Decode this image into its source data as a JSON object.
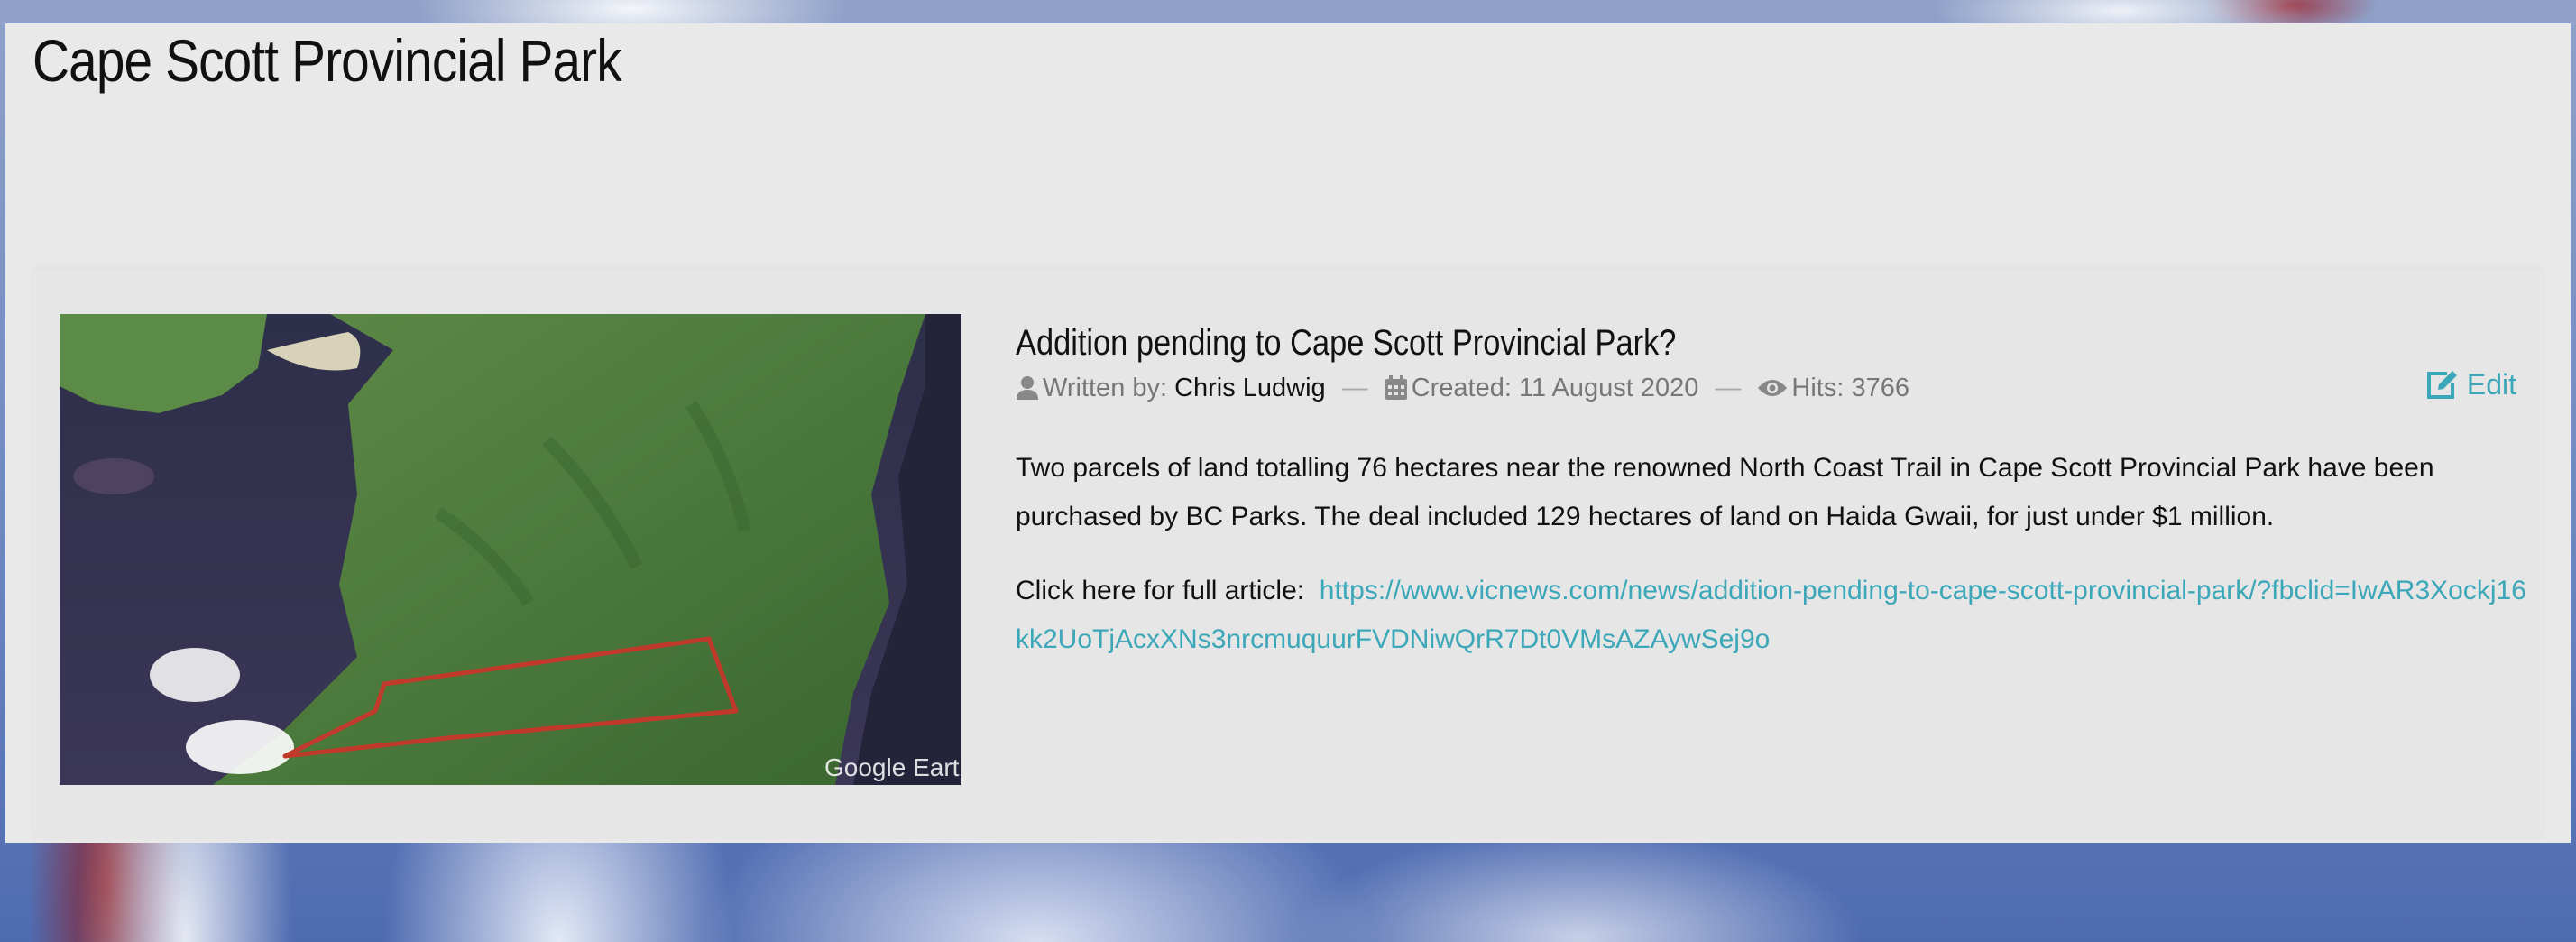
{
  "page": {
    "title": "Cape Scott Provincial Park"
  },
  "article": {
    "title": "Addition pending to Cape Scott Provincial Park?",
    "image_watermark": "Google Earth",
    "meta": {
      "written_by_label": "Written by:",
      "author": "Chris Ludwig",
      "separator": "—",
      "created": "Created: 11 August 2020",
      "hits": "Hits: 3766"
    },
    "edit_label": "Edit",
    "body": "Two parcels of land totalling 76 hectares near the renowned North Coast Trail in Cape Scott Provincial Park have been purchased by BC Parks. The deal included 129 hectares of land on Haida Gwaii, for just under $1 million.",
    "link_intro": "Click here for full article:",
    "link_text": "https://www.vicnews.com/news/addition-pending-to-cape-scott-provincial-park/?fbclid=IwAR3Xockj16kk2UoTjAcxXNs3nrcmuquurFVDNiwQrR7Dt0VMsAZAywSej9o"
  },
  "icons": {
    "author": "user-icon",
    "created": "calendar-icon",
    "hits": "eye-icon",
    "edit": "edit-icon"
  },
  "colors": {
    "accent": "#3ba7b8",
    "panel": "#e9e9e9",
    "meta_text": "#777777"
  }
}
